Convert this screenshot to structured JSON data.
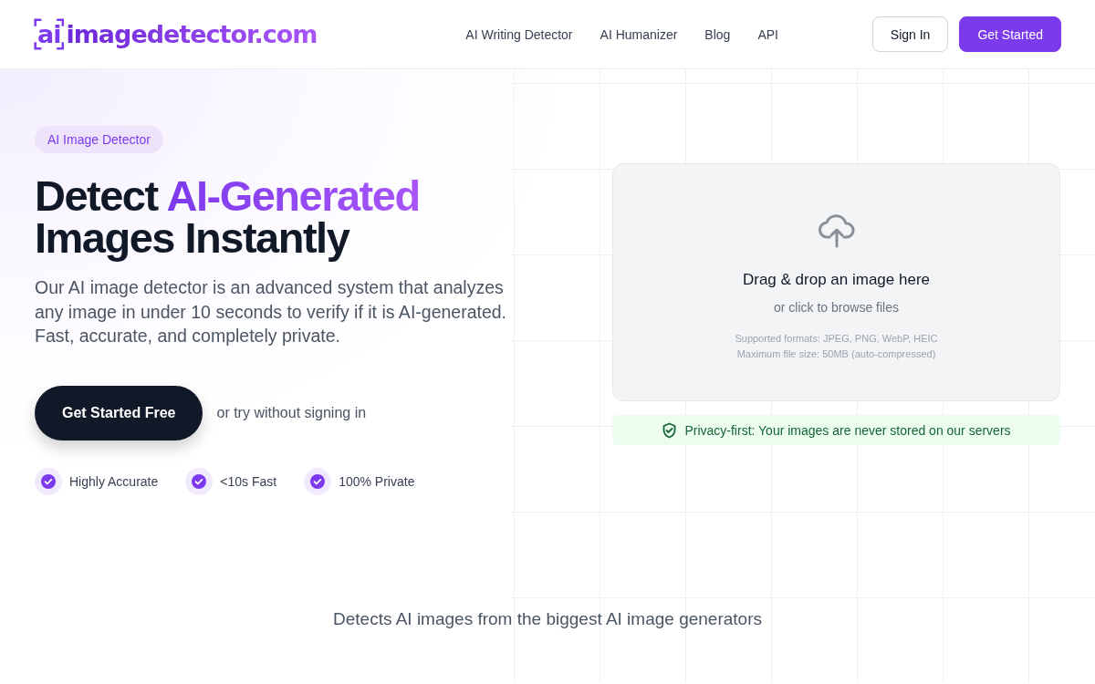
{
  "header": {
    "logo_mark": "ai",
    "logo_text": "imagedetector.com",
    "nav": [
      {
        "label": "AI Writing Detector"
      },
      {
        "label": "AI Humanizer"
      },
      {
        "label": "Blog"
      },
      {
        "label": "API"
      }
    ],
    "buttons": [
      {
        "label": "Sign In",
        "kind": "outline"
      },
      {
        "label": "Get Started",
        "kind": "primary"
      }
    ]
  },
  "hero": {
    "badge": "AI Image Detector",
    "title_start": "Detect ",
    "title_highlight": "AI-Generated",
    "title_end": "Images Instantly",
    "description": "Our AI image detector is an advanced system that analyzes any image in under 10 seconds to verify if it is AI-generated. Fast, accurate, and completely private.",
    "cta": "Get Started Free",
    "cta_note": "or try without signing in",
    "features": [
      {
        "label": "Highly Accurate"
      },
      {
        "label": "<10s Fast"
      },
      {
        "label": "100% Private"
      }
    ]
  },
  "upload": {
    "title": "Drag & drop an image here",
    "subtitle": "or click to browse files",
    "formats": "Supported formats: JPEG, PNG, WebP, HEIC",
    "max_size": "Maximum file size: 50MB (auto-compressed)",
    "privacy": "Privacy-first: Your images are never stored on our servers"
  },
  "generators_heading": "Detects AI images from the biggest AI image generators"
}
